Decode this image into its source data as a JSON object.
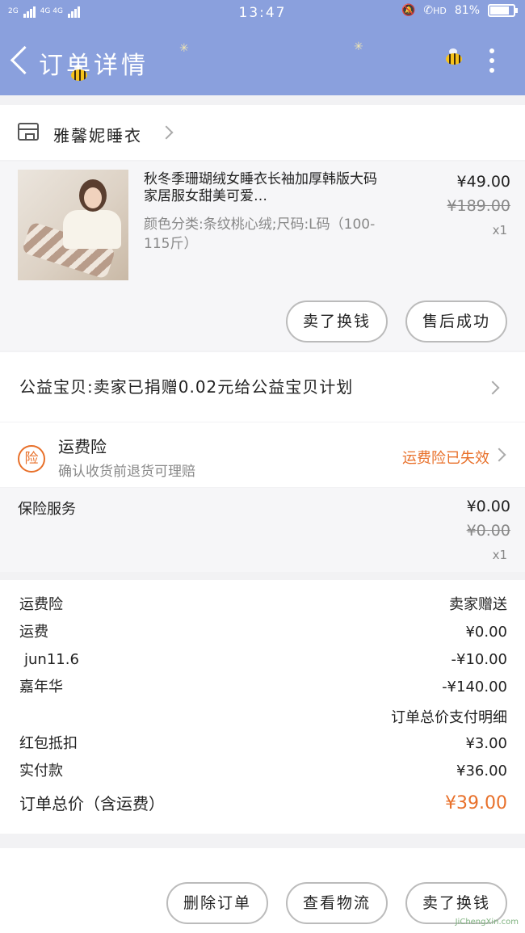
{
  "status_bar": {
    "left_tag_1": "2G",
    "left_tag_2": "4G 4G",
    "time": "13:47",
    "hd": "HD",
    "battery": "81%",
    "battery_level": 0.81
  },
  "header": {
    "title": "订单详情"
  },
  "store": {
    "name": "雅馨妮睡衣"
  },
  "product": {
    "title": "秋冬季珊瑚绒女睡衣长袖加厚韩版大码家居服女甜美可爱…",
    "spec": "颜色分类:条纹桃心绒;尺码:L码（100-115斤）",
    "price": "¥49.00",
    "original_price": "¥189.00",
    "quantity": "x1",
    "actions": [
      "卖了换钱",
      "售后成功"
    ]
  },
  "charity": {
    "text": "公益宝贝:卖家已捐赠0.02元给公益宝贝计划"
  },
  "shipping_insurance": {
    "badge": "险",
    "title": "运费险",
    "subtitle": "确认收货前退货可理赔",
    "status": "运费险已失效"
  },
  "insurance_service": {
    "label": "保险服务",
    "price": "¥0.00",
    "original_price": "¥0.00",
    "quantity": "x1"
  },
  "payment": {
    "rows": [
      {
        "label": "运费险",
        "value": "卖家赠送"
      },
      {
        "label": "运费",
        "value": "¥0.00"
      },
      {
        "label": "jun11.6",
        "value": "-¥10.00"
      },
      {
        "label": "嘉年华",
        "value": "-¥140.00"
      }
    ],
    "detail_link": "订单总价支付明细",
    "rows2": [
      {
        "label": "红包抵扣",
        "value": "¥3.00"
      },
      {
        "label": "实付款",
        "value": "¥36.00"
      }
    ],
    "total_label": "订单总价（含运费）",
    "total_value": "¥39.00"
  },
  "bottom_actions": [
    "删除订单",
    "查看物流",
    "卖了换钱"
  ],
  "watermark": "JiChengXin.com",
  "colors": {
    "header": "#8aa0dd",
    "accent": "#e8702a",
    "page_bg": "#f2f2f4"
  }
}
